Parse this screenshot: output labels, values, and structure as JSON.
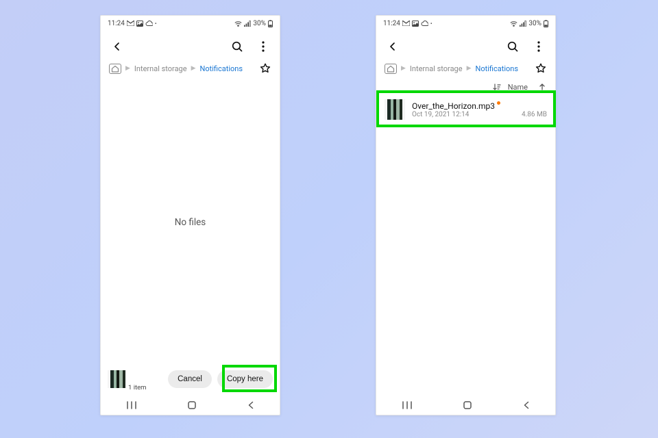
{
  "status": {
    "time": "11:24",
    "battery": "30%"
  },
  "breadcrumb": {
    "internal": "Internal storage",
    "current": "Notifications"
  },
  "left": {
    "empty_label": "No files",
    "copybar": {
      "count": "1 item",
      "cancel": "Cancel",
      "copy": "Copy here"
    }
  },
  "right": {
    "sort_label": "Name",
    "file": {
      "name": "Over_the_Horizon.mp3",
      "date": "Oct 19, 2021 12:14",
      "size": "4.86 MB"
    }
  }
}
